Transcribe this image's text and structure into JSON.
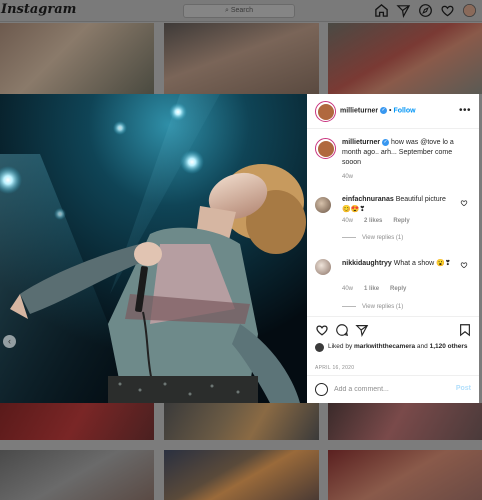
{
  "app": {
    "logo": "Instagram"
  },
  "search": {
    "placeholder": "Search"
  },
  "nav_icons": [
    "home-icon",
    "direct-icon",
    "explore-icon",
    "activity-heart-icon",
    "profile-avatar"
  ],
  "post": {
    "username": "millieturner",
    "follow_label": "Follow",
    "separator": "•",
    "more_label": "•••",
    "caption": {
      "username": "millieturner",
      "text": "how was @tove lo a month ago.. arh... September come sooon",
      "age": "40w"
    },
    "comments": [
      {
        "username": "einfachnuranas",
        "text": "Beautiful picture 😊😍❣",
        "age": "40w",
        "likes": "2 likes",
        "reply": "Reply",
        "view_replies": "View replies (1)"
      },
      {
        "username": "nikkidaughtryy",
        "text": "What a show 😮❣",
        "age": "40w",
        "likes": "1 like",
        "reply": "Reply",
        "view_replies": "View replies (1)"
      }
    ],
    "liked_by_prefix": "Liked by",
    "liked_by_user": "markwiththecamera",
    "liked_by_conj": "and",
    "liked_by_others": "1,120 others",
    "date": "APRIL 16, 2020",
    "add_comment_placeholder": "Add a comment...",
    "post_button": "Post"
  },
  "colors": {
    "accent": "#0095f6",
    "post_disabled": "#b2dffc",
    "story_ring": "#c9357f",
    "overlay": "#7c7c7c"
  }
}
